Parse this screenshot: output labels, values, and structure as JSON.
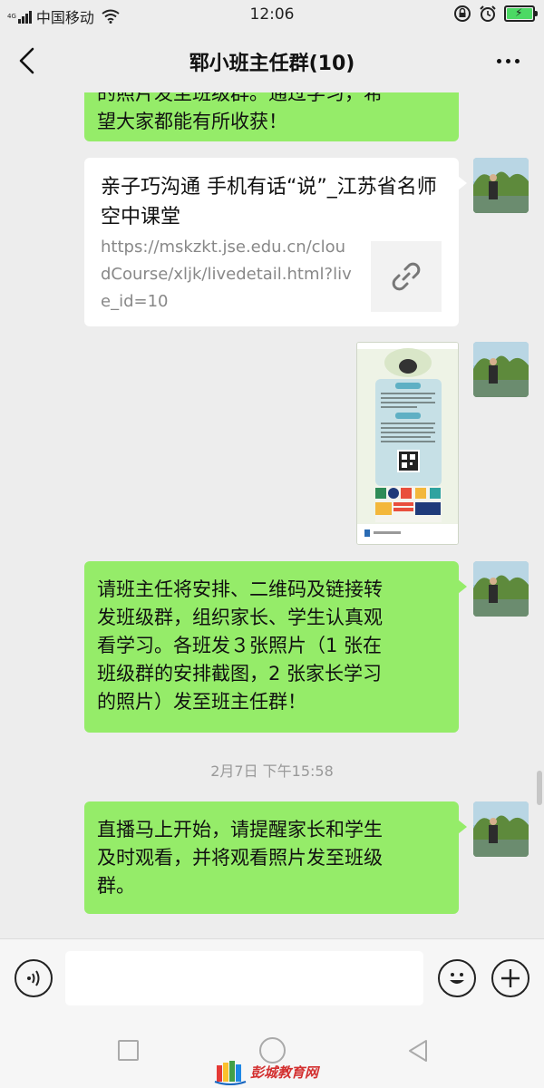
{
  "status_bar": {
    "network": "4G",
    "carrier": "中国移动",
    "time": "12:06"
  },
  "header": {
    "title": "郓小班主任群(10)"
  },
  "messages": {
    "m1_lines": [
      "的照片发至班级群。通过学习，希",
      "望大家都能有所收获！"
    ],
    "link": {
      "title": "亲子巧沟通 手机有话“说”_江苏省名师空中课堂",
      "url": "https://mskzkt.jse.edu.cn/cloudCourse/xljk/livedetail.html?live_id=10"
    },
    "m3_lines": [
      "请班主任将安排、二维码及链接转",
      "发班级群，组织家长、学生认真观",
      "看学习。各班发３张照片（1 张在",
      "班级群的安排截图，2 张家长学习",
      "的照片）发至班主任群！"
    ],
    "timestamp": "2月7日 下午15:58",
    "m4_lines": [
      "直播马上开始，请提醒家长和学生",
      "及时观看，并将观看照片发至班级",
      "群。"
    ]
  },
  "input": {
    "placeholder": ""
  },
  "watermark": {
    "text": "彭城教育网"
  },
  "colors": {
    "bubble": "#95ec69",
    "background": "#ededed",
    "battery": "#4cd964"
  },
  "icons": [
    "back-arrow-icon",
    "more-dots-icon",
    "link-icon",
    "voice-icon",
    "emoji-icon",
    "plus-icon",
    "wifi-icon",
    "battery-icon",
    "alarm-icon",
    "lock-icon"
  ]
}
